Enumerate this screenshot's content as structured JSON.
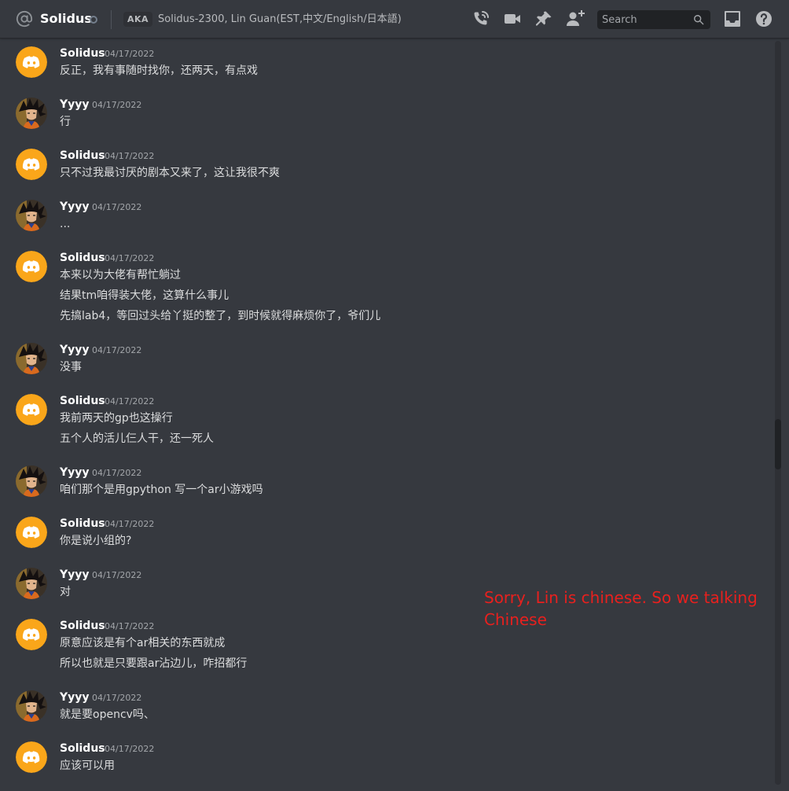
{
  "header": {
    "dm_name": "Solidus",
    "aka_label": "AKA",
    "aka_names": "Solidus-2300, Lin Guan(EST,中文/English/日本語)",
    "search_placeholder": "Search",
    "icons": [
      "at-icon",
      "start-voice-call-icon",
      "start-video-call-icon",
      "pinned-messages-icon",
      "add-friends-to-dm-icon",
      "search-icon",
      "inbox-icon",
      "help-icon"
    ]
  },
  "messages": [
    {
      "author": "Solidus",
      "avatar": "discord-logo",
      "timestamp": "04/17/2022",
      "lines": [
        "反正，我有事随时找你，还两天，有点戏"
      ]
    },
    {
      "author": "Yyyy",
      "avatar": "goku-avatar",
      "timestamp": "04/17/2022",
      "lines": [
        "行"
      ]
    },
    {
      "author": "Solidus",
      "avatar": "discord-logo",
      "timestamp": "04/17/2022",
      "lines": [
        "只不过我最讨厌的剧本又来了，这让我很不爽"
      ]
    },
    {
      "author": "Yyyy",
      "avatar": "goku-avatar",
      "timestamp": "04/17/2022",
      "lines": [
        "..."
      ]
    },
    {
      "author": "Solidus",
      "avatar": "discord-logo",
      "timestamp": "04/17/2022",
      "lines": [
        "本来以为大佬有帮忙躺过",
        "结果tm咱得装大佬，这算什么事儿",
        "先搞lab4，等回过头给丫挺的整了，到时候就得麻烦你了，爷们儿"
      ]
    },
    {
      "author": "Yyyy",
      "avatar": "goku-avatar",
      "timestamp": "04/17/2022",
      "lines": [
        "没事"
      ]
    },
    {
      "author": "Solidus",
      "avatar": "discord-logo",
      "timestamp": "04/17/2022",
      "lines": [
        "我前两天的gp也这操行",
        "五个人的活儿仨人干，还一死人"
      ]
    },
    {
      "author": "Yyyy",
      "avatar": "goku-avatar",
      "timestamp": "04/17/2022",
      "lines": [
        "咱们那个是用gpython 写一个ar小游戏吗"
      ]
    },
    {
      "author": "Solidus",
      "avatar": "discord-logo",
      "timestamp": "04/17/2022",
      "lines": [
        "你是说小组的?"
      ]
    },
    {
      "author": "Yyyy",
      "avatar": "goku-avatar",
      "timestamp": "04/17/2022",
      "lines": [
        "对"
      ]
    },
    {
      "author": "Solidus",
      "avatar": "discord-logo",
      "timestamp": "04/17/2022",
      "lines": [
        "原意应该是有个ar相关的东西就成",
        "所以也就是只要跟ar沾边儿，咋招都行"
      ]
    },
    {
      "author": "Yyyy",
      "avatar": "goku-avatar",
      "timestamp": "04/17/2022",
      "lines": [
        "就是要opencv吗、"
      ]
    },
    {
      "author": "Solidus",
      "avatar": "discord-logo",
      "timestamp": "04/17/2022",
      "lines": [
        "应该可以用"
      ]
    }
  ],
  "annotation": {
    "text": "Sorry, Lin is chinese. So we talking Chinese",
    "color": "#e8201e"
  },
  "colors": {
    "background": "#36393f",
    "discord_yellow": "#faa61a",
    "username": "#ffffff",
    "message_text": "#dcddde",
    "timestamp": "#a3a6aa"
  }
}
